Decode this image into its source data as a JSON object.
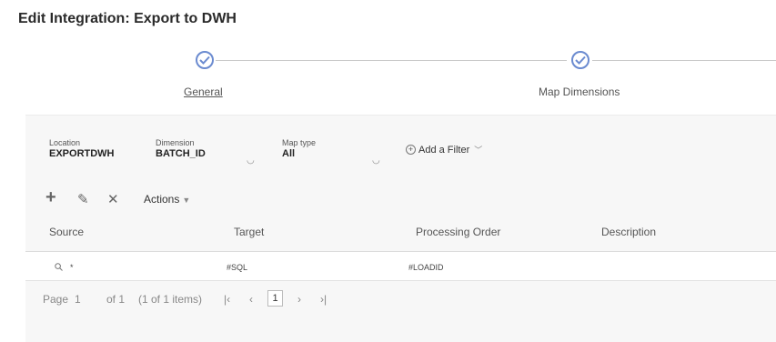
{
  "page_title": "Edit Integration: Export to DWH",
  "steps": [
    {
      "label": "General",
      "status": "complete",
      "current": true
    },
    {
      "label": "Map Dimensions",
      "status": "complete",
      "current": false
    }
  ],
  "filters": {
    "location": {
      "label": "Location",
      "value": "EXPORTDWH"
    },
    "dimension": {
      "label": "Dimension",
      "value": "BATCH_ID"
    },
    "map_type": {
      "label": "Map type",
      "value": "All"
    },
    "add_filter_label": "Add a Filter"
  },
  "toolbar": {
    "add_icon": "+",
    "edit_icon": "✎",
    "delete_icon": "✕",
    "actions_label": "Actions"
  },
  "table": {
    "columns": [
      "Source",
      "Target",
      "Processing Order",
      "Description"
    ],
    "rows": [
      {
        "source": "*",
        "target": "#SQL",
        "processing_order": "#LOADID",
        "description": ""
      }
    ]
  },
  "pagination": {
    "page_label": "Page",
    "page_value": "1",
    "of_label": "of 1",
    "items_summary": "(1 of 1 items)",
    "current_page": "1"
  },
  "colors": {
    "accent": "#6b8bd0",
    "panel_bg": "#f7f7f7"
  }
}
